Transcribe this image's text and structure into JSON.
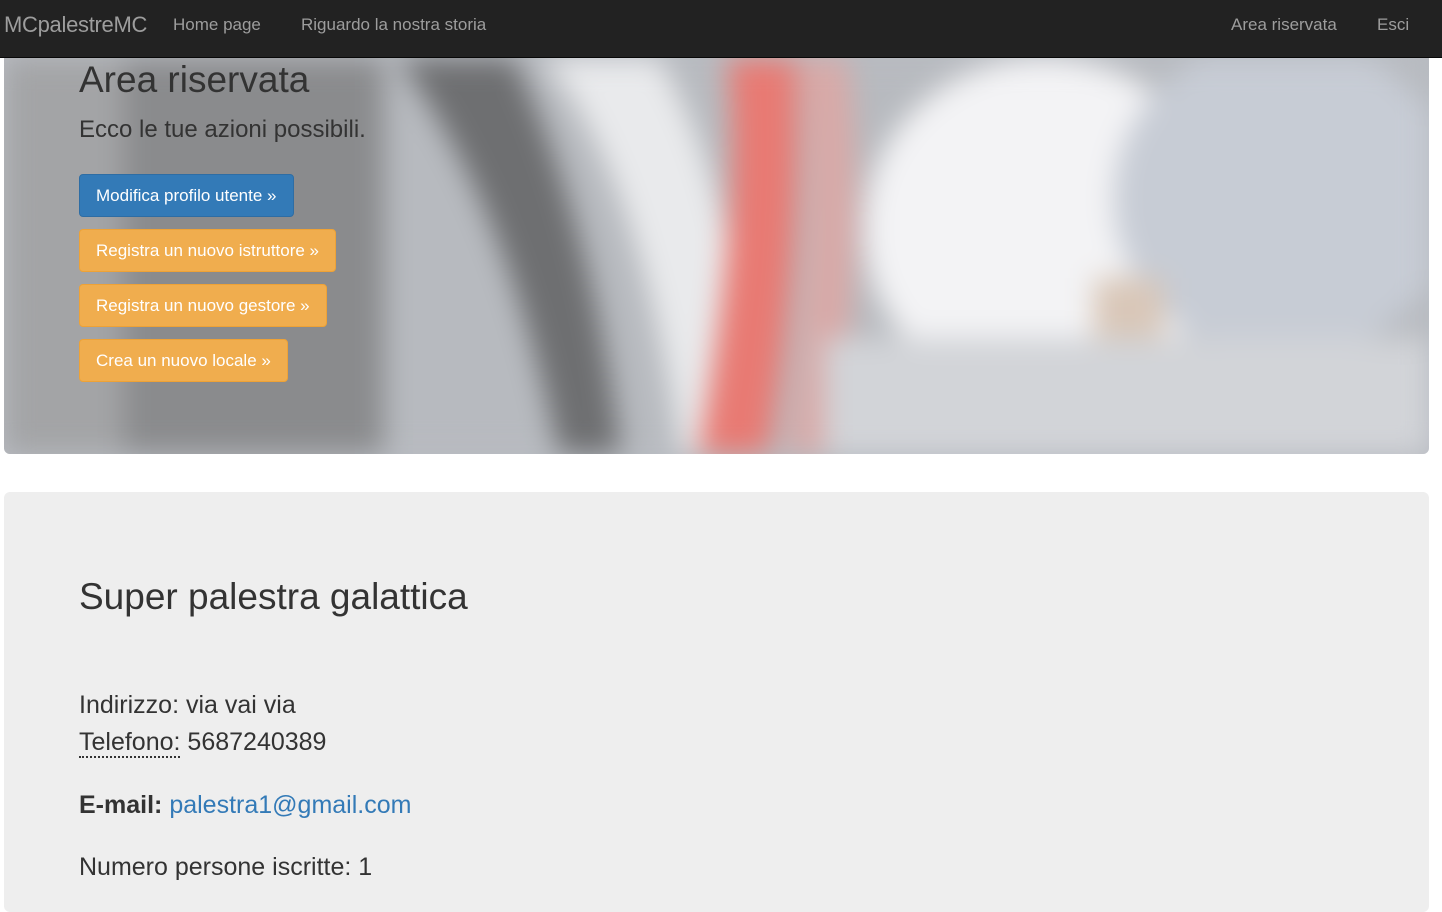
{
  "navbar": {
    "brand": "MCpalestreMC",
    "home": "Home page",
    "story": "Riguardo la nostra storia",
    "reserved": "Area riservata",
    "logout": "Esci"
  },
  "hero": {
    "title": "Area riservata",
    "subtitle": "Ecco le tue azioni possibili.",
    "buttons": [
      {
        "label": "Modifica profilo utente »",
        "style": "primary"
      },
      {
        "label": "Registra un nuovo istruttore »",
        "style": "warning"
      },
      {
        "label": "Registra un nuovo gestore »",
        "style": "warning"
      },
      {
        "label": "Crea un nuovo locale »",
        "style": "warning"
      }
    ]
  },
  "gym": {
    "name": "Super palestra galattica",
    "address_label": "Indirizzo:",
    "address": "via vai via",
    "phone_label": "Telefono:",
    "phone": "5687240389",
    "email_label": "E-mail:",
    "email": "palestra1@gmail.com",
    "members_label": "Numero persone iscritte:",
    "members": "1"
  },
  "colors": {
    "navbar_bg": "#222222",
    "nav_text": "#9d9d9d",
    "primary": "#337ab7",
    "warning": "#f0ad4e",
    "panel_bg": "#eeeeee",
    "link": "#337ab7"
  }
}
